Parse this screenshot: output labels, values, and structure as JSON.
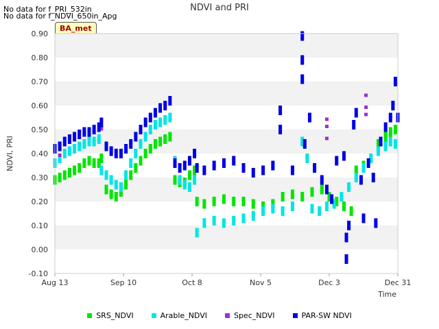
{
  "notes": [
    "No data for f_PRI_532in",
    "No data for f_NDVI_650in_Apg"
  ],
  "badge": "BA_met",
  "chart_data": {
    "type": "scatter",
    "title": "NDVI and PRI",
    "xlabel": "Time",
    "ylabel": "NDVI, PRI",
    "x_range": [
      "2016-08-13",
      "2016-12-31"
    ],
    "ylim": [
      -0.1,
      0.9
    ],
    "y_ticks": [
      "-0.10",
      "0.00",
      "0.10",
      "0.20",
      "0.30",
      "0.40",
      "0.50",
      "0.60",
      "0.70",
      "0.80",
      "0.90"
    ],
    "x_ticks": [
      {
        "date": "2016-08-13",
        "label": "Aug 13"
      },
      {
        "date": "2016-09-10",
        "label": "Sep 10"
      },
      {
        "date": "2016-10-08",
        "label": "Oct 8"
      },
      {
        "date": "2016-11-05",
        "label": "Nov 5"
      },
      {
        "date": "2016-12-03",
        "label": "Dec 3"
      },
      {
        "date": "2016-12-31",
        "label": "Dec 31"
      }
    ],
    "grid": "alternating horizontal bands",
    "legend_position": "bottom",
    "series": [
      {
        "name": "SRS_NDVI",
        "color": "#00e600",
        "points": [
          [
            "2016-08-13",
            0.29
          ],
          [
            "2016-08-15",
            0.3
          ],
          [
            "2016-08-17",
            0.31
          ],
          [
            "2016-08-19",
            0.32
          ],
          [
            "2016-08-21",
            0.33
          ],
          [
            "2016-08-23",
            0.34
          ],
          [
            "2016-08-25",
            0.36
          ],
          [
            "2016-08-27",
            0.37
          ],
          [
            "2016-08-29",
            0.36
          ],
          [
            "2016-08-31",
            0.36
          ],
          [
            "2016-09-01",
            0.38
          ],
          [
            "2016-09-03",
            0.25
          ],
          [
            "2016-09-05",
            0.23
          ],
          [
            "2016-09-07",
            0.22
          ],
          [
            "2016-09-09",
            0.24
          ],
          [
            "2016-09-11",
            0.27
          ],
          [
            "2016-09-13",
            0.31
          ],
          [
            "2016-09-15",
            0.34
          ],
          [
            "2016-09-17",
            0.37
          ],
          [
            "2016-09-19",
            0.4
          ],
          [
            "2016-09-21",
            0.42
          ],
          [
            "2016-09-23",
            0.44
          ],
          [
            "2016-09-25",
            0.45
          ],
          [
            "2016-09-27",
            0.46
          ],
          [
            "2016-09-29",
            0.47
          ],
          [
            "2016-10-01",
            0.29
          ],
          [
            "2016-10-03",
            0.28
          ],
          [
            "2016-10-05",
            0.28
          ],
          [
            "2016-10-07",
            0.31
          ],
          [
            "2016-10-09",
            0.33
          ],
          [
            "2016-10-10",
            0.2
          ],
          [
            "2016-10-13",
            0.19
          ],
          [
            "2016-10-17",
            0.2
          ],
          [
            "2016-10-21",
            0.21
          ],
          [
            "2016-10-25",
            0.2
          ],
          [
            "2016-10-29",
            0.2
          ],
          [
            "2016-11-02",
            0.19
          ],
          [
            "2016-11-06",
            0.18
          ],
          [
            "2016-11-10",
            0.19
          ],
          [
            "2016-11-14",
            0.22
          ],
          [
            "2016-11-18",
            0.23
          ],
          [
            "2016-11-22",
            0.22
          ],
          [
            "2016-11-26",
            0.24
          ],
          [
            "2016-11-30",
            0.25
          ],
          [
            "2016-12-03",
            0.22
          ],
          [
            "2016-12-06",
            0.2
          ],
          [
            "2016-12-09",
            0.18
          ],
          [
            "2016-12-12",
            0.16
          ],
          [
            "2016-12-14",
            0.33
          ],
          [
            "2016-12-17",
            0.35
          ],
          [
            "2016-12-20",
            0.38
          ],
          [
            "2016-12-23",
            0.44
          ],
          [
            "2016-12-26",
            0.47
          ],
          [
            "2016-12-28",
            0.49
          ],
          [
            "2016-12-30",
            0.5
          ]
        ]
      },
      {
        "name": "Arable_NDVI",
        "color": "#00e5e5",
        "points": [
          [
            "2016-08-13",
            0.36
          ],
          [
            "2016-08-15",
            0.38
          ],
          [
            "2016-08-17",
            0.4
          ],
          [
            "2016-08-19",
            0.41
          ],
          [
            "2016-08-21",
            0.42
          ],
          [
            "2016-08-23",
            0.43
          ],
          [
            "2016-08-25",
            0.44
          ],
          [
            "2016-08-27",
            0.45
          ],
          [
            "2016-08-29",
            0.45
          ],
          [
            "2016-08-31",
            0.46
          ],
          [
            "2016-09-01",
            0.33
          ],
          [
            "2016-09-03",
            0.31
          ],
          [
            "2016-09-05",
            0.29
          ],
          [
            "2016-09-07",
            0.27
          ],
          [
            "2016-09-09",
            0.26
          ],
          [
            "2016-09-11",
            0.31
          ],
          [
            "2016-09-13",
            0.36
          ],
          [
            "2016-09-15",
            0.4
          ],
          [
            "2016-09-17",
            0.44
          ],
          [
            "2016-09-19",
            0.47
          ],
          [
            "2016-09-21",
            0.5
          ],
          [
            "2016-09-23",
            0.52
          ],
          [
            "2016-09-25",
            0.53
          ],
          [
            "2016-09-27",
            0.54
          ],
          [
            "2016-09-29",
            0.55
          ],
          [
            "2016-10-01",
            0.37
          ],
          [
            "2016-10-03",
            0.29
          ],
          [
            "2016-10-05",
            0.27
          ],
          [
            "2016-10-07",
            0.26
          ],
          [
            "2016-10-09",
            0.29
          ],
          [
            "2016-10-10",
            0.07
          ],
          [
            "2016-10-13",
            0.11
          ],
          [
            "2016-10-17",
            0.12
          ],
          [
            "2016-10-21",
            0.11
          ],
          [
            "2016-10-25",
            0.12
          ],
          [
            "2016-10-29",
            0.13
          ],
          [
            "2016-11-02",
            0.14
          ],
          [
            "2016-11-06",
            0.16
          ],
          [
            "2016-11-10",
            0.17
          ],
          [
            "2016-11-14",
            0.16
          ],
          [
            "2016-11-18",
            0.18
          ],
          [
            "2016-11-22",
            0.45
          ],
          [
            "2016-11-24",
            0.38
          ],
          [
            "2016-11-26",
            0.17
          ],
          [
            "2016-11-29",
            0.16
          ],
          [
            "2016-12-02",
            0.18
          ],
          [
            "2016-12-05",
            0.19
          ],
          [
            "2016-12-08",
            0.22
          ],
          [
            "2016-12-11",
            0.26
          ],
          [
            "2016-12-14",
            0.3
          ],
          [
            "2016-12-17",
            0.34
          ],
          [
            "2016-12-20",
            0.38
          ],
          [
            "2016-12-23",
            0.41
          ],
          [
            "2016-12-26",
            0.43
          ],
          [
            "2016-12-28",
            0.45
          ],
          [
            "2016-12-30",
            0.44
          ]
        ]
      },
      {
        "name": "Spec_NDVI",
        "color": "#9a32cd",
        "points": [
          [
            "2016-08-15",
            0.38
          ],
          [
            "2016-09-01",
            0.49
          ],
          [
            "2016-12-02",
            0.53
          ],
          [
            "2016-12-02",
            0.5
          ],
          [
            "2016-12-02",
            0.45
          ],
          [
            "2016-12-18",
            0.63
          ],
          [
            "2016-12-18",
            0.58
          ],
          [
            "2016-12-18",
            0.55
          ]
        ]
      },
      {
        "name": "PAR-SW NDVI",
        "color": "#0000e6",
        "points": [
          [
            "2016-08-13",
            0.42
          ],
          [
            "2016-08-15",
            0.43
          ],
          [
            "2016-08-17",
            0.45
          ],
          [
            "2016-08-19",
            0.46
          ],
          [
            "2016-08-21",
            0.47
          ],
          [
            "2016-08-23",
            0.48
          ],
          [
            "2016-08-25",
            0.49
          ],
          [
            "2016-08-27",
            0.49
          ],
          [
            "2016-08-29",
            0.5
          ],
          [
            "2016-08-31",
            0.51
          ],
          [
            "2016-09-01",
            0.53
          ],
          [
            "2016-09-03",
            0.43
          ],
          [
            "2016-09-05",
            0.41
          ],
          [
            "2016-09-07",
            0.4
          ],
          [
            "2016-09-09",
            0.4
          ],
          [
            "2016-09-11",
            0.42
          ],
          [
            "2016-09-13",
            0.44
          ],
          [
            "2016-09-15",
            0.47
          ],
          [
            "2016-09-17",
            0.5
          ],
          [
            "2016-09-19",
            0.53
          ],
          [
            "2016-09-21",
            0.55
          ],
          [
            "2016-09-23",
            0.57
          ],
          [
            "2016-09-25",
            0.59
          ],
          [
            "2016-09-27",
            0.6
          ],
          [
            "2016-09-29",
            0.62
          ],
          [
            "2016-10-01",
            0.36
          ],
          [
            "2016-10-03",
            0.34
          ],
          [
            "2016-10-05",
            0.35
          ],
          [
            "2016-10-07",
            0.37
          ],
          [
            "2016-10-09",
            0.4
          ],
          [
            "2016-10-10",
            0.34
          ],
          [
            "2016-10-13",
            0.33
          ],
          [
            "2016-10-17",
            0.35
          ],
          [
            "2016-10-21",
            0.36
          ],
          [
            "2016-10-25",
            0.37
          ],
          [
            "2016-10-29",
            0.34
          ],
          [
            "2016-11-02",
            0.32
          ],
          [
            "2016-11-06",
            0.33
          ],
          [
            "2016-11-10",
            0.35
          ],
          [
            "2016-11-13",
            0.58
          ],
          [
            "2016-11-13",
            0.5
          ],
          [
            "2016-11-18",
            0.33
          ],
          [
            "2016-11-22",
            0.89
          ],
          [
            "2016-11-22",
            0.79
          ],
          [
            "2016-11-22",
            0.71
          ],
          [
            "2016-11-23",
            0.44
          ],
          [
            "2016-11-25",
            0.55
          ],
          [
            "2016-11-27",
            0.34
          ],
          [
            "2016-11-30",
            0.29
          ],
          [
            "2016-12-02",
            0.25
          ],
          [
            "2016-12-04",
            0.21
          ],
          [
            "2016-12-06",
            0.37
          ],
          [
            "2016-12-09",
            0.39
          ],
          [
            "2016-12-10",
            0.05
          ],
          [
            "2016-12-10",
            -0.04
          ],
          [
            "2016-12-11",
            0.1
          ],
          [
            "2016-12-13",
            0.52
          ],
          [
            "2016-12-14",
            0.57
          ],
          [
            "2016-12-16",
            0.29
          ],
          [
            "2016-12-17",
            0.13
          ],
          [
            "2016-12-19",
            0.36
          ],
          [
            "2016-12-21",
            0.3
          ],
          [
            "2016-12-22",
            0.11
          ],
          [
            "2016-12-24",
            0.45
          ],
          [
            "2016-12-26",
            0.51
          ],
          [
            "2016-12-28",
            0.55
          ],
          [
            "2016-12-29",
            0.6
          ],
          [
            "2016-12-30",
            0.7
          ],
          [
            "2016-12-31",
            0.55
          ]
        ]
      }
    ]
  }
}
